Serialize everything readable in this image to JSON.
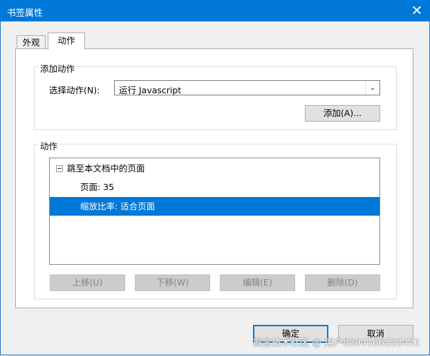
{
  "window": {
    "title": "书签属性",
    "close_glyph": "✕"
  },
  "tabs": [
    {
      "label": "外观",
      "active": false
    },
    {
      "label": "动作",
      "active": true
    }
  ],
  "add_action_group": {
    "title": "添加动作",
    "select_label": "选择动作(N):",
    "select_value": "运行 Javascript",
    "add_button": "添加(A)..."
  },
  "actions_group": {
    "title": "动作",
    "tree": [
      {
        "label": "跳至本文档中的页面",
        "expandable": true,
        "selected": false
      },
      {
        "label": "页面: 35",
        "selected": false
      },
      {
        "label": "缩放比率: 适合页面",
        "selected": true
      }
    ],
    "buttons": [
      {
        "label": "上移(U)",
        "enabled": false
      },
      {
        "label": "下移(W)",
        "enabled": false
      },
      {
        "label": "编辑(E)",
        "enabled": false
      },
      {
        "label": "删除(D)",
        "enabled": false
      }
    ]
  },
  "dialog_buttons": {
    "ok": "确定",
    "cancel": "取消"
  },
  "watermark": "掘金技术社区 @ 用户8394166222431",
  "colors": {
    "accent": "#0078d7",
    "selection": "#0078d7"
  }
}
